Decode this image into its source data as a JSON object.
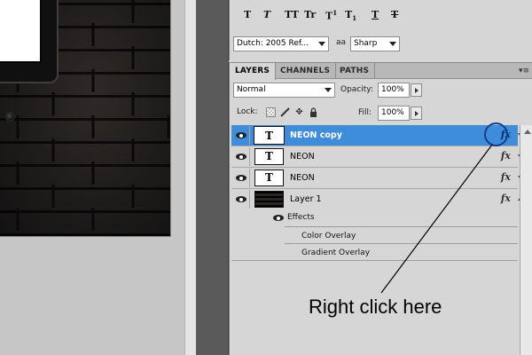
{
  "character_panel": {
    "style_buttons": [
      "T",
      "T",
      "TT",
      "Tr",
      "T",
      "1",
      "T",
      "1",
      "T",
      "T"
    ],
    "language": "Dutch: 2005 Ref...",
    "antialias_icon": "aa",
    "antialias": "Sharp"
  },
  "layers_panel": {
    "tabs": [
      "LAYERS",
      "CHANNELS",
      "PATHS"
    ],
    "menu_icon": "▾≡",
    "blend_mode": "Normal",
    "opacity_label": "Opacity:",
    "opacity_value": "100%",
    "lock_label": "Lock:",
    "fill_label": "Fill:",
    "fill_value": "100%",
    "lock_move_glyph": "✥",
    "layers": [
      {
        "name": "NEON copy",
        "thumb": "T",
        "fx": "fx",
        "selected": true
      },
      {
        "name": "NEON",
        "thumb": "T",
        "fx": "fx"
      },
      {
        "name": "NEON",
        "thumb": "T",
        "fx": "fx"
      },
      {
        "name": "Layer 1",
        "thumb": "",
        "fx": "fx"
      }
    ],
    "effects_label": "Effects",
    "effects": [
      "Color Overlay",
      "Gradient Overlay"
    ]
  },
  "annotation": {
    "callout_text": "Right click here",
    "accent_color": "#3e8ddb",
    "ring_color": "#173a8c"
  }
}
